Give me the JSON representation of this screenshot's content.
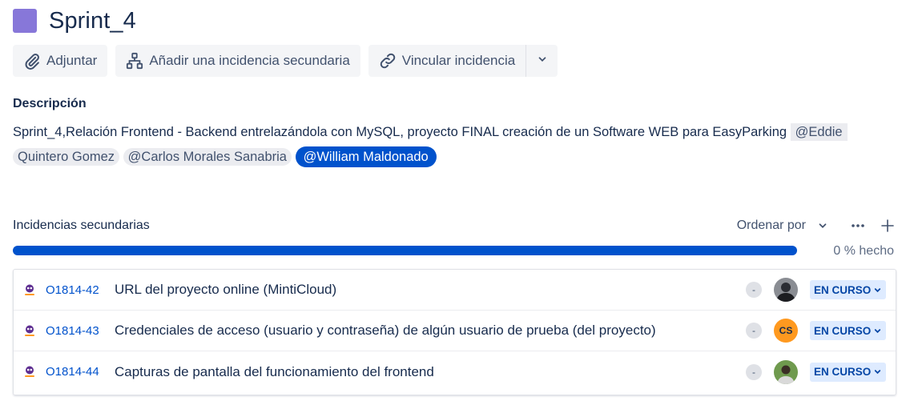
{
  "epic": {
    "title": "Sprint_4",
    "color": "#8777d9"
  },
  "actions": {
    "attach": "Adjuntar",
    "add_child": "Añadir una incidencia secundaria",
    "link": "Vincular incidencia"
  },
  "description": {
    "label": "Descripción",
    "text": "Sprint_4,Relación Frontend - Backend entrelazándola con MySQL, proyecto FINAL creación de un Software WEB para EasyParking ",
    "mention1_part1": "@Eddie",
    "mention1_part2": "Quintero Gomez",
    "mention2": "@Carlos Morales Sanabria",
    "mention3": "@William Maldonado"
  },
  "child_issues": {
    "title": "Incidencias secundarias",
    "sort_label": "Ordenar por",
    "progress_text": "0 % hecho",
    "progress_done": 0,
    "items": [
      {
        "key": "O1814-42",
        "summary": "URL del proyecto online (MintiCloud)",
        "priority": "-",
        "assignee": "",
        "status": "EN CURSO"
      },
      {
        "key": "O1814-43",
        "summary": "Credenciales de acceso (usuario y contraseña) de algún usuario de prueba (del proyecto)",
        "priority": "-",
        "assignee": "CS",
        "status": "EN CURSO"
      },
      {
        "key": "O1814-44",
        "summary": "Capturas de pantalla del funcionamiento del frontend",
        "priority": "-",
        "assignee": "",
        "status": "EN CURSO"
      }
    ]
  },
  "colors": {
    "accent": "#0052cc",
    "status_bg": "#deebff",
    "status_text": "#0747a6"
  }
}
